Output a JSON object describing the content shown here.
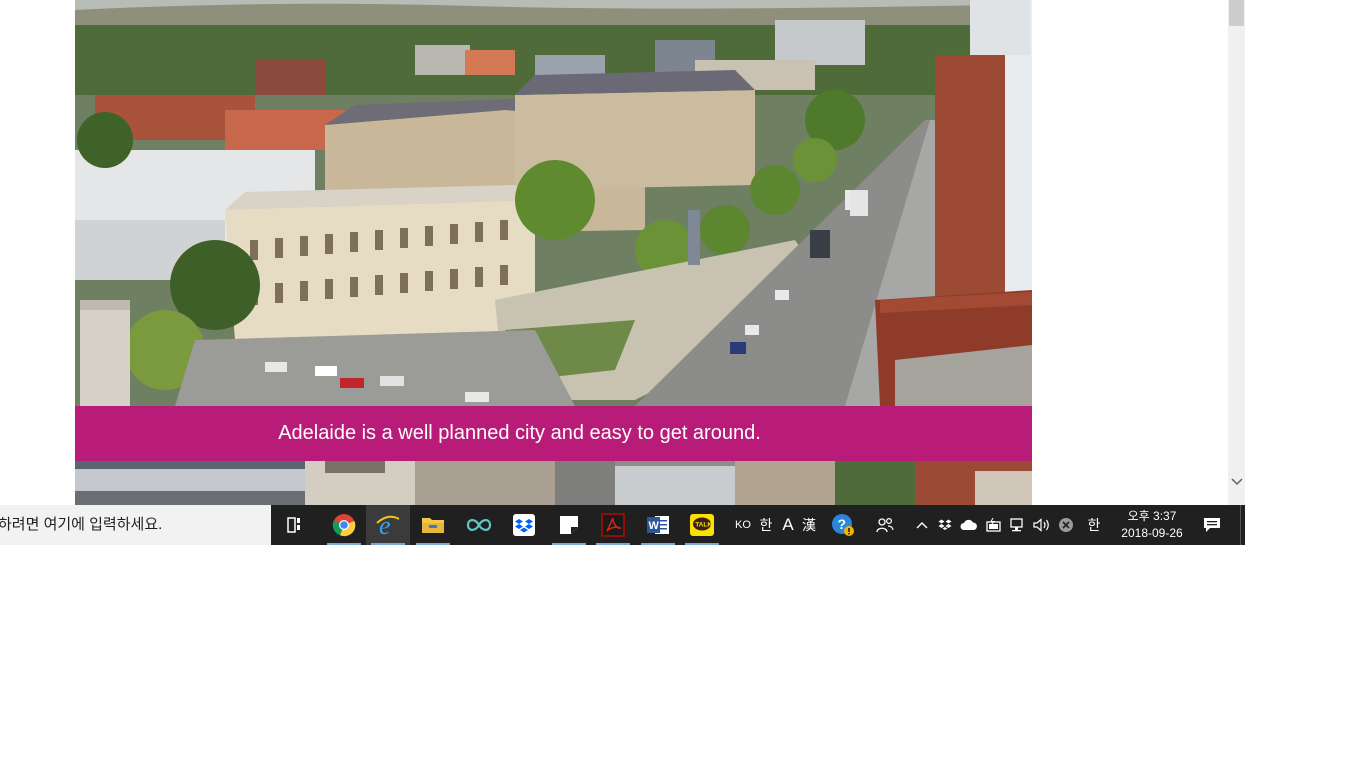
{
  "page": {
    "caption": "Adelaide is a well planned city and easy to get around.",
    "accent_color": "#b81c78"
  },
  "taskbar": {
    "search_placeholder": "하려면 여기에 입력하세요.",
    "apps": [
      "task-view-icon",
      "chrome-icon",
      "internet-explorer-icon",
      "file-explorer-icon",
      "infinity-app-icon",
      "dropbox-icon",
      "sticky-notes-icon",
      "acrobat-icon",
      "word-icon",
      "kakaotalk-icon"
    ],
    "tray": {
      "ime_lang": "KO",
      "ime_mode": "한",
      "ime_font": "A",
      "ime_hanja": "漢",
      "ime_right": "한"
    },
    "clock": {
      "time": "오후 3:37",
      "date": "2018-09-26"
    }
  }
}
